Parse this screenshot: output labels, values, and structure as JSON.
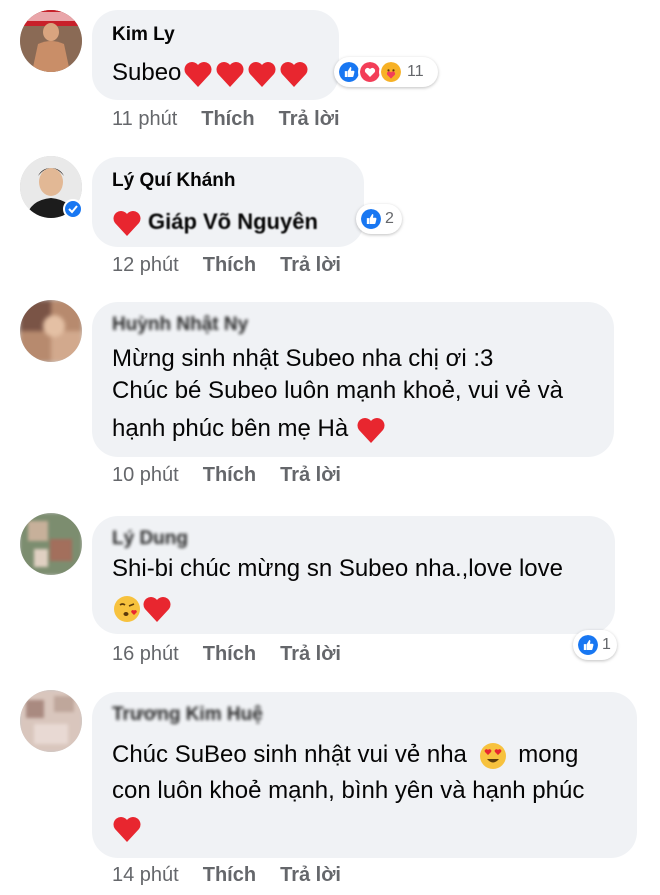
{
  "comments": [
    {
      "author": "Kim Ly",
      "text": "Subeo",
      "hearts": 4,
      "reaction_count": "11",
      "time": "11 phút",
      "like_label": "Thích",
      "reply_label": "Trả lời"
    },
    {
      "author": "Lý Quí Khánh",
      "text": "Giáp Võ Nguyên",
      "reaction_count": "2",
      "time": "12 phút",
      "like_label": "Thích",
      "reply_label": "Trả lời"
    },
    {
      "author": "Huỳnh Nhật Ny",
      "line1": "Mừng sinh nhật Subeo nha chị ơi :3",
      "line2": "Chúc bé Subeo luôn mạnh khoẻ, vui vẻ và",
      "line3": "hạnh phúc bên mẹ Hà",
      "time": "10 phút",
      "like_label": "Thích",
      "reply_label": "Trả lời"
    },
    {
      "author": "Lý Dung",
      "line1": "Shi-bi chúc mừng sn Subeo nha.,love love",
      "reaction_count": "1",
      "time": "16 phút",
      "like_label": "Thích",
      "reply_label": "Trả lời"
    },
    {
      "author": "Trương Kim Huệ",
      "line1": "Chúc SuBeo sinh nhật vui vẻ nha",
      "line1b": "mong",
      "line2": "con luôn khoẻ mạnh, bình yên và hạnh phúc",
      "time": "14 phút",
      "like_label": "Thích",
      "reply_label": "Trả lời"
    }
  ],
  "colors": {
    "bubble": "#f0f2f5",
    "meta": "#65676b",
    "like_blue": "#1877f2",
    "heart_red": "#e8262f"
  },
  "icons": [
    "like-reaction-icon",
    "love-reaction-icon",
    "care-reaction-icon",
    "verified-badge-icon",
    "heart-emoji",
    "heart-eyes-emoji",
    "kiss-emoji"
  ]
}
